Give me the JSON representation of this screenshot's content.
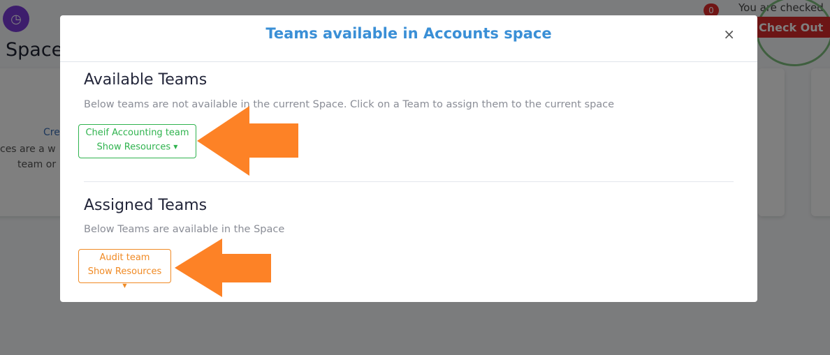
{
  "background": {
    "avatar_icon": "clock-icon",
    "page_title": "Space",
    "card_left_lines": [
      "Cre",
      "ces are a w",
      "team or"
    ],
    "notification_count": "0",
    "checked_in_text": "You are checked",
    "checkout_label": "Check Out"
  },
  "modal": {
    "title": "Teams available in Accounts space",
    "close_label": "×",
    "available": {
      "heading": "Available Teams",
      "description": "Below teams are not available in the current Space. Click on a Team to assign them to the current space",
      "teams": [
        {
          "name": "Cheif Accounting team",
          "resources_label": "Show Resources"
        }
      ]
    },
    "assigned": {
      "heading": "Assigned Teams",
      "description": "Below Teams are available in the Space",
      "teams": [
        {
          "name": "Audit team",
          "resources_label": "Show Resources"
        }
      ]
    }
  },
  "colors": {
    "title_blue": "#3a8fd6",
    "available_green": "#2fb34e",
    "assigned_orange": "#f08a24",
    "annotation_arrow": "#fd8226",
    "checkout_red": "#d92a2a"
  }
}
